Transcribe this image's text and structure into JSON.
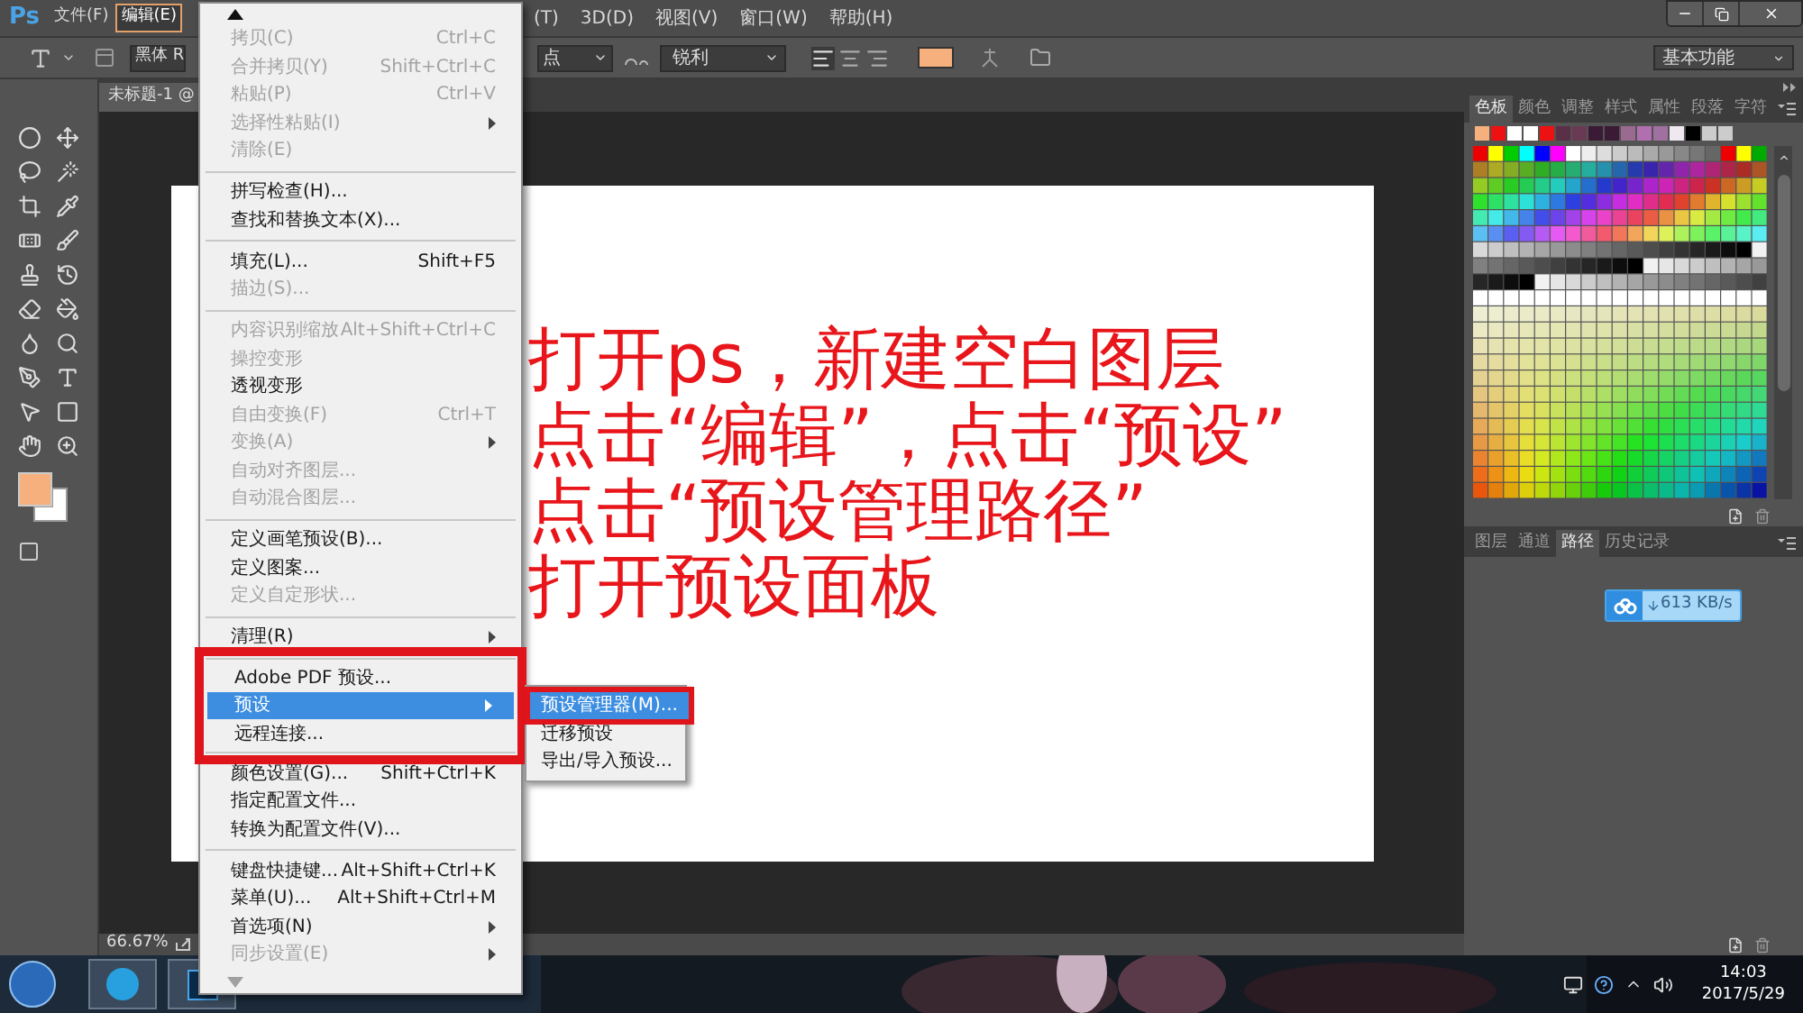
{
  "app_logo": "Ps",
  "menu_bar": [
    {
      "label": "文件(F)",
      "selected": false
    },
    {
      "label": "编辑(E)",
      "selected": true
    },
    {
      "label": "(T)",
      "selected": false
    },
    {
      "label": "3D(D)",
      "selected": false
    },
    {
      "label": "视图(V)",
      "selected": false
    },
    {
      "label": "窗口(W)",
      "selected": false
    },
    {
      "label": "帮助(H)",
      "selected": false
    }
  ],
  "options_bar": {
    "font_family": "黑体 R",
    "font_size_unit": "点",
    "antialias": "锐利",
    "workspace": "基本功能"
  },
  "document_tab": "未标题-1 @",
  "zoom": "66.67%",
  "edit_menu": [
    {
      "annotated": false,
      "items": [
        {
          "label": "拷贝(C)",
          "shortcut": "Ctrl+C",
          "disabled": true,
          "has_submenu": false,
          "selected": false
        },
        {
          "label": "合并拷贝(Y)",
          "shortcut": "Shift+Ctrl+C",
          "disabled": true,
          "has_submenu": false,
          "selected": false
        },
        {
          "label": "粘贴(P)",
          "shortcut": "Ctrl+V",
          "disabled": true,
          "has_submenu": false,
          "selected": false
        },
        {
          "label": "选择性粘贴(I)",
          "disabled": true,
          "has_submenu": true,
          "selected": false
        },
        {
          "label": "清除(E)",
          "disabled": true,
          "has_submenu": false,
          "selected": false
        }
      ]
    },
    {
      "annotated": false,
      "items": [
        {
          "label": "拼写检查(H)...",
          "disabled": false,
          "has_submenu": false,
          "selected": false
        },
        {
          "label": "查找和替换文本(X)...",
          "disabled": false,
          "has_submenu": false,
          "selected": false
        }
      ]
    },
    {
      "annotated": false,
      "items": [
        {
          "label": "填充(L)...",
          "shortcut": "Shift+F5",
          "disabled": false,
          "has_submenu": false,
          "selected": false
        },
        {
          "label": "描边(S)...",
          "disabled": true,
          "has_submenu": false,
          "selected": false
        }
      ]
    },
    {
      "annotated": false,
      "items": [
        {
          "label": "内容识别缩放",
          "shortcut": "Alt+Shift+Ctrl+C",
          "disabled": true,
          "has_submenu": false,
          "selected": false
        },
        {
          "label": "操控变形",
          "disabled": true,
          "has_submenu": false,
          "selected": false
        },
        {
          "label": "透视变形",
          "disabled": false,
          "has_submenu": false,
          "selected": false
        },
        {
          "label": "自由变换(F)",
          "shortcut": "Ctrl+T",
          "disabled": true,
          "has_submenu": false,
          "selected": false
        },
        {
          "label": "变换(A)",
          "disabled": true,
          "has_submenu": true,
          "selected": false
        },
        {
          "label": "自动对齐图层...",
          "disabled": true,
          "has_submenu": false,
          "selected": false
        },
        {
          "label": "自动混合图层...",
          "disabled": true,
          "has_submenu": false,
          "selected": false
        }
      ]
    },
    {
      "annotated": false,
      "items": [
        {
          "label": "定义画笔预设(B)...",
          "disabled": false,
          "has_submenu": false,
          "selected": false
        },
        {
          "label": "定义图案...",
          "disabled": false,
          "has_submenu": false,
          "selected": false
        },
        {
          "label": "定义自定形状...",
          "disabled": true,
          "has_submenu": false,
          "selected": false
        }
      ]
    },
    {
      "annotated": false,
      "items": [
        {
          "label": "清理(R)",
          "disabled": false,
          "has_submenu": true,
          "selected": false
        }
      ]
    },
    {
      "annotated": true,
      "items": [
        {
          "label": "Adobe PDF 预设...",
          "disabled": false,
          "has_submenu": false,
          "selected": false
        },
        {
          "label": "预设",
          "disabled": false,
          "has_submenu": true,
          "selected": true,
          "submenu_items": [
            {
              "label": "预设管理器(M)...",
              "selected": true,
              "annotated": true
            },
            {
              "label": "迁移预设",
              "selected": false,
              "annotated": false
            },
            {
              "label": "导出/导入预设...",
              "selected": false,
              "annotated": false
            }
          ]
        },
        {
          "label": "远程连接...",
          "disabled": false,
          "has_submenu": false,
          "selected": false
        }
      ]
    },
    {
      "annotated": false,
      "items": [
        {
          "label": "颜色设置(G)...",
          "shortcut": "Shift+Ctrl+K",
          "disabled": false,
          "has_submenu": false,
          "selected": false
        },
        {
          "label": "指定配置文件...",
          "disabled": false,
          "has_submenu": false,
          "selected": false
        },
        {
          "label": "转换为配置文件(V)...",
          "disabled": false,
          "has_submenu": false,
          "selected": false
        }
      ]
    },
    {
      "annotated": false,
      "items": [
        {
          "label": "键盘快捷键...",
          "shortcut": "Alt+Shift+Ctrl+K",
          "disabled": false,
          "has_submenu": false,
          "selected": false
        },
        {
          "label": "菜单(U)...",
          "shortcut": "Alt+Shift+Ctrl+M",
          "disabled": false,
          "has_submenu": false,
          "selected": false
        },
        {
          "label": "首选项(N)",
          "disabled": false,
          "has_submenu": true,
          "selected": false
        },
        {
          "label": "同步设置(E)",
          "disabled": true,
          "has_submenu": true,
          "selected": false
        }
      ]
    }
  ],
  "swatches_panel": {
    "tabs": [
      {
        "label": "色板",
        "selected": true
      },
      {
        "label": "颜色",
        "selected": false
      },
      {
        "label": "调整",
        "selected": false
      },
      {
        "label": "样式",
        "selected": false
      },
      {
        "label": "属性",
        "selected": false
      },
      {
        "label": "段落",
        "selected": false
      },
      {
        "label": "字符",
        "selected": false
      }
    ]
  },
  "paths_panel": {
    "tabs": [
      {
        "label": "图层",
        "selected": false
      },
      {
        "label": "通道",
        "selected": false
      },
      {
        "label": "路径",
        "selected": true
      },
      {
        "label": "历史记录",
        "selected": false
      }
    ]
  },
  "download_speed": "613 KB/s",
  "taskbar": {
    "time": "14:03",
    "date": "2017/5/29"
  },
  "annotation": [
    "打开ps，新建空白图层",
    "点击“编辑”，点击“预设”",
    "点击“预设管理路径”",
    "打开预设面板"
  ]
}
